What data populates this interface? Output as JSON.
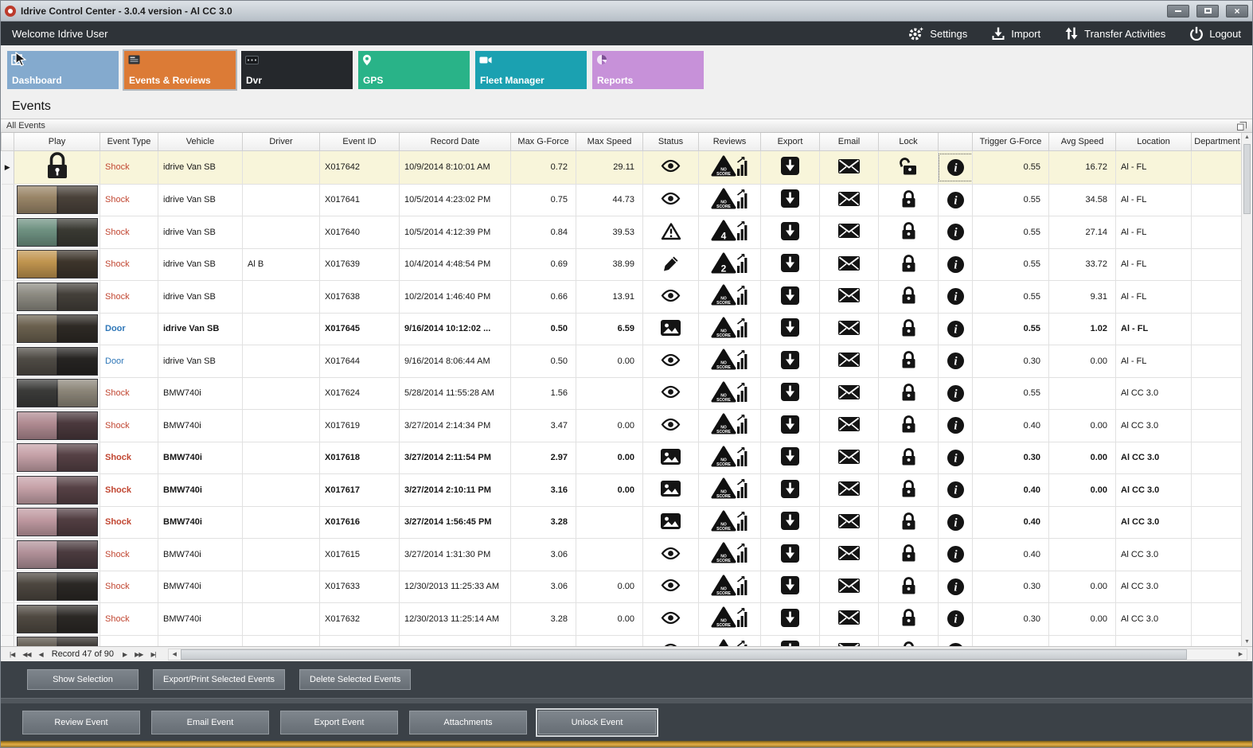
{
  "window": {
    "title": "Idrive Control Center - 3.0.4 version - Al CC 3.0"
  },
  "topbar": {
    "welcome": "Welcome Idrive User",
    "actions": [
      {
        "id": "settings",
        "icon": "gear-icon",
        "label": "Settings"
      },
      {
        "id": "import",
        "icon": "import-icon",
        "label": "Import"
      },
      {
        "id": "transfer",
        "icon": "transfer-arrows-icon",
        "label": "Transfer Activities"
      },
      {
        "id": "logout",
        "icon": "power-icon",
        "label": "Logout"
      }
    ]
  },
  "nav": {
    "tiles": [
      {
        "id": "dashboard",
        "label": "Dashboard",
        "color": "#84aace",
        "active": false
      },
      {
        "id": "events",
        "label": "Events & Reviews",
        "color": "#dc7b36",
        "active": true
      },
      {
        "id": "dvr",
        "label": "Dvr",
        "color": "#25282c",
        "active": false
      },
      {
        "id": "gps",
        "label": "GPS",
        "color": "#29b388",
        "active": false
      },
      {
        "id": "fleet",
        "label": "Fleet Manager",
        "color": "#1ba1b1",
        "active": false
      },
      {
        "id": "reports",
        "label": "Reports",
        "color": "#c791d9",
        "active": false
      }
    ]
  },
  "page": {
    "title": "Events",
    "group_header": "All Events"
  },
  "colors": {
    "shock_text": "#c14631",
    "door_text": "#2f77b8",
    "selected_row_bg": "#f8f5da",
    "accent_stripe": "#c8952f"
  },
  "table": {
    "columns": [
      "",
      "Play",
      "Event Type",
      "Vehicle",
      "Driver",
      "Event ID",
      "Record Date",
      "Max G-Force",
      "Max Speed",
      "Status",
      "Reviews",
      "Export",
      "Email",
      "Lock",
      "",
      "Trigger G-Force",
      "Avg Speed",
      "Location",
      "Department"
    ],
    "rows": [
      {
        "selected": true,
        "play": "lock",
        "event_type": "Shock",
        "type": "shock",
        "vehicle": "idrive Van SB",
        "driver": "",
        "event_id": "X017642",
        "record_date": "10/9/2014 8:10:01 AM",
        "max_g": "0.72",
        "max_speed": "29.11",
        "status": "eye",
        "review": "NO SCORE",
        "lock": "unlocked",
        "info_focus": true,
        "trigger_g": "0.55",
        "avg_speed": "16.72",
        "location": "Al - FL",
        "department": ""
      },
      {
        "play": "thumb",
        "thumb": [
          "#9a8668",
          "#4a423a"
        ],
        "event_type": "Shock",
        "type": "shock",
        "vehicle": "idrive Van SB",
        "driver": "",
        "event_id": "X017641",
        "record_date": "10/5/2014 4:23:02 PM",
        "max_g": "0.75",
        "max_speed": "44.73",
        "status": "eye",
        "review": "NO SCORE",
        "lock": "locked",
        "trigger_g": "0.55",
        "avg_speed": "34.58",
        "location": "Al - FL",
        "department": ""
      },
      {
        "play": "thumb",
        "thumb": [
          "#6f9282",
          "#3a3a33"
        ],
        "event_type": "Shock",
        "type": "shock",
        "vehicle": "idrive Van SB",
        "driver": "",
        "event_id": "X017640",
        "record_date": "10/5/2014 4:12:39 PM",
        "max_g": "0.84",
        "max_speed": "39.53",
        "status": "warning",
        "review": "4",
        "lock": "locked",
        "trigger_g": "0.55",
        "avg_speed": "27.14",
        "location": "Al - FL",
        "department": ""
      },
      {
        "play": "thumb",
        "thumb": [
          "#c1954f",
          "#3d352b"
        ],
        "event_type": "Shock",
        "type": "shock",
        "vehicle": "idrive Van SB",
        "driver": "Al B",
        "event_id": "X017639",
        "record_date": "10/4/2014 4:48:54 PM",
        "max_g": "0.69",
        "max_speed": "38.99",
        "status": "pencil",
        "review": "2",
        "lock": "locked",
        "trigger_g": "0.55",
        "avg_speed": "33.72",
        "location": "Al - FL",
        "department": ""
      },
      {
        "play": "thumb",
        "thumb": [
          "#8d8b82",
          "#44403a"
        ],
        "event_type": "Shock",
        "type": "shock",
        "vehicle": "idrive Van SB",
        "driver": "",
        "event_id": "X017638",
        "record_date": "10/2/2014 1:46:40 PM",
        "max_g": "0.66",
        "max_speed": "13.91",
        "status": "eye",
        "review": "NO SCORE",
        "lock": "locked",
        "trigger_g": "0.55",
        "avg_speed": "9.31",
        "location": "Al - FL",
        "department": ""
      },
      {
        "bold": true,
        "play": "thumb",
        "thumb": [
          "#6b614f",
          "#2e2a25"
        ],
        "event_type": "Door",
        "type": "door",
        "vehicle": "idrive Van SB",
        "driver": "",
        "event_id": "X017645",
        "record_date": "9/16/2014 10:12:02 ...",
        "max_g": "0.50",
        "max_speed": "6.59",
        "status": "picture",
        "review": "NO SCORE",
        "lock": "locked",
        "trigger_g": "0.55",
        "avg_speed": "1.02",
        "location": "Al - FL",
        "department": ""
      },
      {
        "play": "thumb",
        "thumb": [
          "#4f4b45",
          "#262422"
        ],
        "event_type": "Door",
        "type": "door",
        "vehicle": "idrive Van SB",
        "driver": "",
        "event_id": "X017644",
        "record_date": "9/16/2014 8:06:44 AM",
        "max_g": "0.50",
        "max_speed": "0.00",
        "status": "eye",
        "review": "NO SCORE",
        "lock": "locked",
        "trigger_g": "0.30",
        "avg_speed": "0.00",
        "location": "Al - FL",
        "department": ""
      },
      {
        "play": "thumb",
        "thumb": [
          "#3b3b39",
          "#8c8679"
        ],
        "event_type": "Shock",
        "type": "shock",
        "vehicle": "BMW740i",
        "driver": "",
        "event_id": "X017624",
        "record_date": "5/28/2014 11:55:28 AM",
        "max_g": "1.56",
        "max_speed": "",
        "status": "eye",
        "review": "NO SCORE",
        "lock": "locked",
        "trigger_g": "0.55",
        "avg_speed": "",
        "location": "Al CC 3.0",
        "department": ""
      },
      {
        "play": "thumb",
        "thumb": [
          "#b08b92",
          "#4b393d"
        ],
        "event_type": "Shock",
        "type": "shock",
        "vehicle": "BMW740i",
        "driver": "",
        "event_id": "X017619",
        "record_date": "3/27/2014 2:14:34 PM",
        "max_g": "3.47",
        "max_speed": "0.00",
        "status": "eye",
        "review": "NO SCORE",
        "lock": "locked",
        "trigger_g": "0.40",
        "avg_speed": "0.00",
        "location": "Al CC 3.0",
        "department": ""
      },
      {
        "bold": true,
        "play": "thumb",
        "thumb": [
          "#c6a2a8",
          "#564145"
        ],
        "event_type": "Shock",
        "type": "shock",
        "vehicle": "BMW740i",
        "driver": "",
        "event_id": "X017618",
        "record_date": "3/27/2014 2:11:54 PM",
        "max_g": "2.97",
        "max_speed": "0.00",
        "status": "picture",
        "review": "NO SCORE",
        "lock": "locked",
        "trigger_g": "0.30",
        "avg_speed": "0.00",
        "location": "Al CC 3.0",
        "department": ""
      },
      {
        "bold": true,
        "play": "thumb",
        "thumb": [
          "#c6a2a8",
          "#564145"
        ],
        "event_type": "Shock",
        "type": "shock",
        "vehicle": "BMW740i",
        "driver": "",
        "event_id": "X017617",
        "record_date": "3/27/2014 2:10:11 PM",
        "max_g": "3.16",
        "max_speed": "0.00",
        "status": "picture",
        "review": "NO SCORE",
        "lock": "locked",
        "trigger_g": "0.40",
        "avg_speed": "0.00",
        "location": "Al CC 3.0",
        "department": ""
      },
      {
        "bold": true,
        "play": "thumb",
        "thumb": [
          "#c09aa1",
          "#523e42"
        ],
        "event_type": "Shock",
        "type": "shock",
        "vehicle": "BMW740i",
        "driver": "",
        "event_id": "X017616",
        "record_date": "3/27/2014 1:56:45 PM",
        "max_g": "3.28",
        "max_speed": "",
        "status": "picture",
        "review": "NO SCORE",
        "lock": "locked",
        "trigger_g": "0.40",
        "avg_speed": "",
        "location": "Al CC 3.0",
        "department": ""
      },
      {
        "play": "thumb",
        "thumb": [
          "#b2929a",
          "#4b3b3f"
        ],
        "event_type": "Shock",
        "type": "shock",
        "vehicle": "BMW740i",
        "driver": "",
        "event_id": "X017615",
        "record_date": "3/27/2014 1:31:30 PM",
        "max_g": "3.06",
        "max_speed": "",
        "status": "eye",
        "review": "NO SCORE",
        "lock": "locked",
        "trigger_g": "0.40",
        "avg_speed": "",
        "location": "Al CC 3.0",
        "department": ""
      },
      {
        "play": "thumb",
        "thumb": [
          "#4d4740",
          "#2b2825"
        ],
        "event_type": "Shock",
        "type": "shock",
        "vehicle": "BMW740i",
        "driver": "",
        "event_id": "X017633",
        "record_date": "12/30/2013 11:25:33 AM",
        "max_g": "3.06",
        "max_speed": "0.00",
        "status": "eye",
        "review": "NO SCORE",
        "lock": "locked",
        "trigger_g": "0.30",
        "avg_speed": "0.00",
        "location": "Al CC 3.0",
        "department": ""
      },
      {
        "play": "thumb",
        "thumb": [
          "#504a42",
          "#2b2825"
        ],
        "event_type": "Shock",
        "type": "shock",
        "vehicle": "BMW740i",
        "driver": "",
        "event_id": "X017632",
        "record_date": "12/30/2013 11:25:14 AM",
        "max_g": "3.28",
        "max_speed": "0.00",
        "status": "eye",
        "review": "NO SCORE",
        "lock": "locked",
        "trigger_g": "0.30",
        "avg_speed": "0.00",
        "location": "Al CC 3.0",
        "department": ""
      },
      {
        "partial": true,
        "play": "thumb",
        "thumb": [
          "#5a5349",
          "#2e2a26"
        ],
        "event_type": "",
        "type": "shock",
        "vehicle": "",
        "driver": "",
        "event_id": "",
        "record_date": "",
        "max_g": "",
        "max_speed": "",
        "status": "eye",
        "review": "NO SCORE",
        "lock": "locked",
        "trigger_g": "",
        "avg_speed": "",
        "location": "",
        "department": ""
      }
    ]
  },
  "footer": {
    "record_text": "Record 47 of 90"
  },
  "selection_actions": {
    "buttons": [
      "Show Selection",
      "Export/Print Selected Events",
      "Delete Selected  Events"
    ]
  },
  "event_actions": {
    "buttons": [
      "Review Event",
      "Email Event",
      "Export Event",
      "Attachments",
      "Unlock Event"
    ],
    "focused": "Unlock Event"
  }
}
